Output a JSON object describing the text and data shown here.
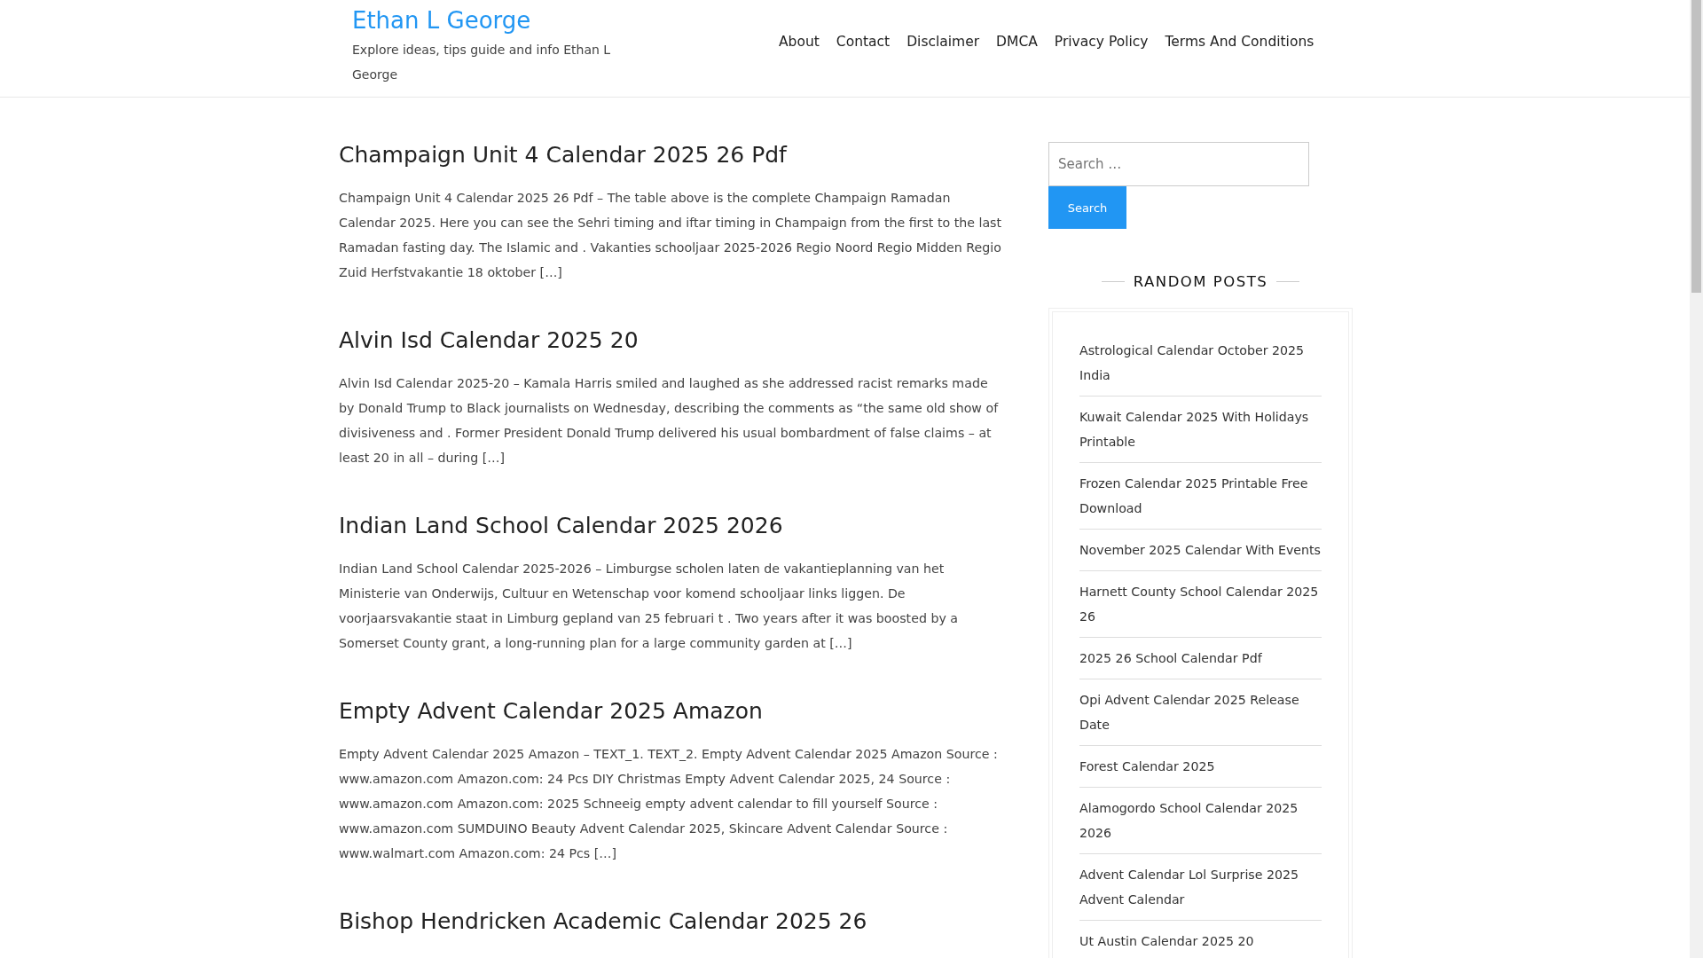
{
  "site": {
    "title": "Ethan L George",
    "tagline": "Explore ideas, tips guide and info Ethan L George"
  },
  "nav": [
    "About",
    "Contact",
    "Disclaimer",
    "DMCA",
    "Privacy Policy",
    "Terms And Conditions"
  ],
  "posts": [
    {
      "title": "Champaign Unit 4 Calendar 2025 26 Pdf",
      "excerpt": "Champaign Unit 4 Calendar 2025 26 Pdf – The table above is the complete Champaign Ramadan Calendar 2025. Here you can see the Sehri timing and iftar timing in Champaign from the first to the last Ramadan fasting day. The Islamic and . Vakanties schooljaar 2025-2026 Regio Noord Regio Midden Regio Zuid Herfstvakantie 18 oktober […]"
    },
    {
      "title": "Alvin Isd Calendar 2025 20",
      "excerpt": "Alvin Isd Calendar 2025-20 – Kamala Harris smiled and laughed as she addressed racist remarks made by Donald Trump to Black journalists on Wednesday, describing the comments as “the same old show of divisiveness and . Former President Donald Trump delivered his usual bombardment of false claims – at least 20 in all – during […]"
    },
    {
      "title": "Indian Land School Calendar 2025 2026",
      "excerpt": "Indian Land School Calendar 2025-2026 – Limburgse scholen laten de vakantieplanning van het Ministerie van Onderwijs, Cultuur en Wetenschap voor komend schooljaar links liggen. De voorjaarsvakantie staat in Limburg gepland van 25 februari t . Two years after it was boosted by a Somerset County grant, a long-running plan for a large community garden at […]"
    },
    {
      "title": "Empty Advent Calendar 2025 Amazon",
      "excerpt": "Empty Advent Calendar 2025 Amazon – TEXT_1. TEXT_2. Empty Advent Calendar 2025 Amazon Source : www.amazon.com Amazon.com: 24 Pcs DIY Christmas Empty Advent Calendar 2025, 24 Source : www.amazon.com Amazon.com: 2025 Schneeig empty advent calendar to fill yourself Source : www.amazon.com SUMDUINO Beauty Advent Calendar 2025, Skincare Advent Calendar Source : www.walmart.com Amazon.com: 24 Pcs […]"
    },
    {
      "title": "Bishop Hendricken Academic Calendar 2025 26"
    }
  ],
  "search": {
    "placeholder": "Search …",
    "button": "Search"
  },
  "random_posts": {
    "heading": "RANDOM POSTS",
    "items": [
      "Astrological Calendar October 2025 India",
      "Kuwait Calendar 2025 With Holidays Printable",
      "Frozen Calendar 2025 Printable Free Download",
      "November 2025 Calendar With Events",
      "Harnett County School Calendar 2025 26",
      "2025 26 School Calendar Pdf",
      "Opi Advent Calendar 2025 Release Date",
      "Forest Calendar 2025",
      "Alamogordo School Calendar 2025 2026",
      "Advent Calendar Lol Surprise 2025 Advent Calendar",
      "Ut Austin Calendar 2025 20"
    ]
  }
}
